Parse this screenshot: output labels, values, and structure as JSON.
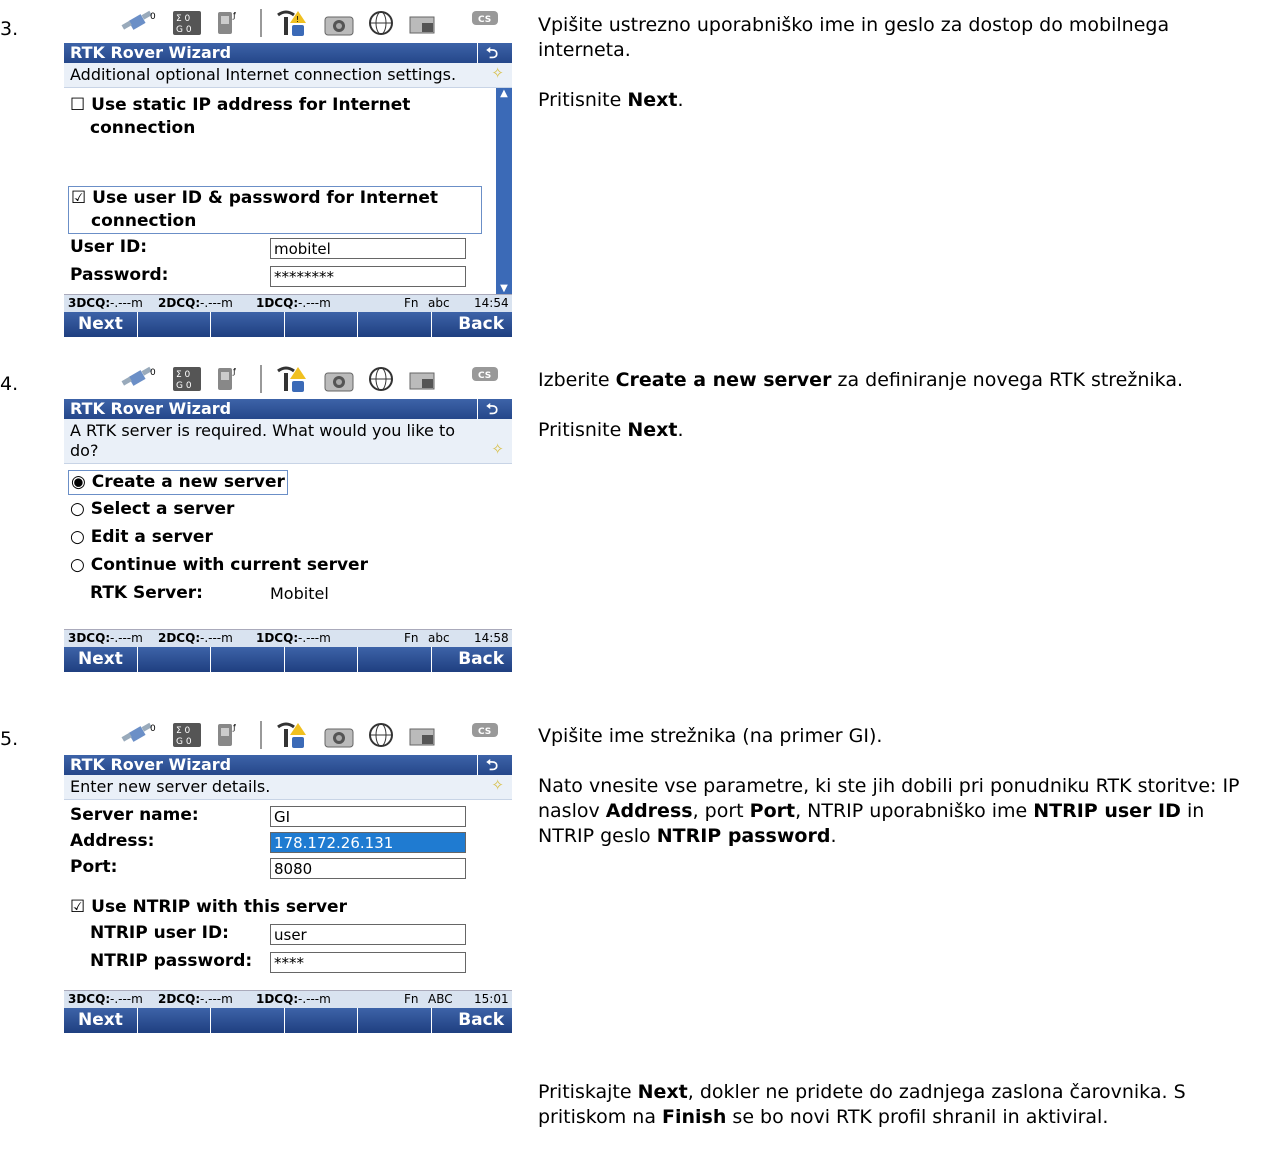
{
  "steps": [
    {
      "number": "3.",
      "wizard_title": "RTK Rover Wizard",
      "subtitle": "Additional optional Internet connection settings.",
      "options": [
        {
          "checked": false,
          "label_line1": "Use static IP address for Internet",
          "label_line2": "connection"
        },
        {
          "checked": true,
          "label_line1": "Use user ID & password for Internet",
          "label_line2": "connection"
        }
      ],
      "fields": [
        {
          "label": "User ID:",
          "value": "mobitel"
        },
        {
          "label": "Password:",
          "value": "********"
        }
      ],
      "status": {
        "q3": "3DCQ:",
        "q3v": "-.---m",
        "q2": "2DCQ:",
        "q2v": "-.---m",
        "q1": "1DCQ:",
        "q1v": "-.---m",
        "fn": "Fn",
        "mode": "abc",
        "time": "14:54"
      },
      "softkeys": {
        "next": "Next",
        "back": "Back"
      },
      "description": [
        {
          "text": "Vpišite ustrezno uporabniško ime in geslo za dostop do mobilnega interneta."
        },
        {
          "prefix": "Pritisnite ",
          "bold": "Next",
          "suffix": "."
        }
      ]
    },
    {
      "number": "4.",
      "wizard_title": "RTK Rover Wizard",
      "subtitle": "A RTK server is required. What would you like to do?",
      "radios": [
        {
          "selected": true,
          "label": "Create a new server"
        },
        {
          "selected": false,
          "label": "Select a server"
        },
        {
          "selected": false,
          "label": "Edit a server"
        },
        {
          "selected": false,
          "label": "Continue with current server"
        }
      ],
      "server_label": "RTK Server:",
      "server_value": "Mobitel",
      "status": {
        "q3": "3DCQ:",
        "q3v": "-.---m",
        "q2": "2DCQ:",
        "q2v": "-.---m",
        "q1": "1DCQ:",
        "q1v": "-.---m",
        "fn": "Fn",
        "mode": "abc",
        "time": "14:58"
      },
      "softkeys": {
        "next": "Next",
        "back": "Back"
      },
      "description": {
        "line1_prefix": "Izberite ",
        "line1_bold": "Create a new server",
        "line1_suffix": " za definiranje novega RTK strežnika.",
        "line2_prefix": "Pritisnite ",
        "line2_bold": "Next",
        "line2_suffix": "."
      }
    },
    {
      "number": "5.",
      "wizard_title": "RTK Rover Wizard",
      "subtitle": "Enter new server details.",
      "fields": [
        {
          "label": "Server name:",
          "value": "GI"
        },
        {
          "label": "Address:",
          "value": "178.172.26.131"
        },
        {
          "label": "Port:",
          "value": "8080"
        }
      ],
      "ntrip_checkbox": "Use NTRIP with this server",
      "ntrip_fields": [
        {
          "label": "NTRIP user ID:",
          "value": "user"
        },
        {
          "label": "NTRIP password:",
          "value": "****"
        }
      ],
      "status": {
        "q3": "3DCQ:",
        "q3v": "-.---m",
        "q2": "2DCQ:",
        "q2v": "-.---m",
        "q1": "1DCQ:",
        "q1v": "-.---m",
        "fn": "Fn",
        "mode": "ABC",
        "time": "15:01"
      },
      "softkeys": {
        "next": "Next",
        "back": "Back"
      },
      "description": {
        "p1": "Vpišite ime strežnika (na primer GI).",
        "p2_a": "Nato vnesite vse parametre, ki ste jih dobili pri ponudniku RTK storitve: IP naslov ",
        "p2_b": "Address",
        "p2_c": ", port ",
        "p2_d": "Port",
        "p2_e": ", NTRIP uporabniško ime ",
        "p2_f": "NTRIP user ID",
        "p2_g": " in NTRIP geslo ",
        "p2_h": "NTRIP password",
        "p2_i": "."
      }
    }
  ],
  "footer": {
    "a": "Pritiskajte ",
    "b": "Next",
    "c": ", dokler ne pridete do zadnjega zaslona čarovnika. S pritiskom na ",
    "d": "Finish",
    "e": " se bo novi RTK profil shranil in aktiviral."
  },
  "icon_bar": [
    "satellite-icon",
    "sigma-g-icon",
    "sim-card-icon",
    "antenna-bluetooth-icon",
    "camera-icon",
    "globe-icon",
    "battery-icon",
    "cs-controller-icon"
  ],
  "colors": {
    "title_blue": "#2f559c",
    "selected_field": "#1f7bd1",
    "subtitle_bg": "#eaf0f8",
    "status_bg": "#d9e3f0"
  }
}
